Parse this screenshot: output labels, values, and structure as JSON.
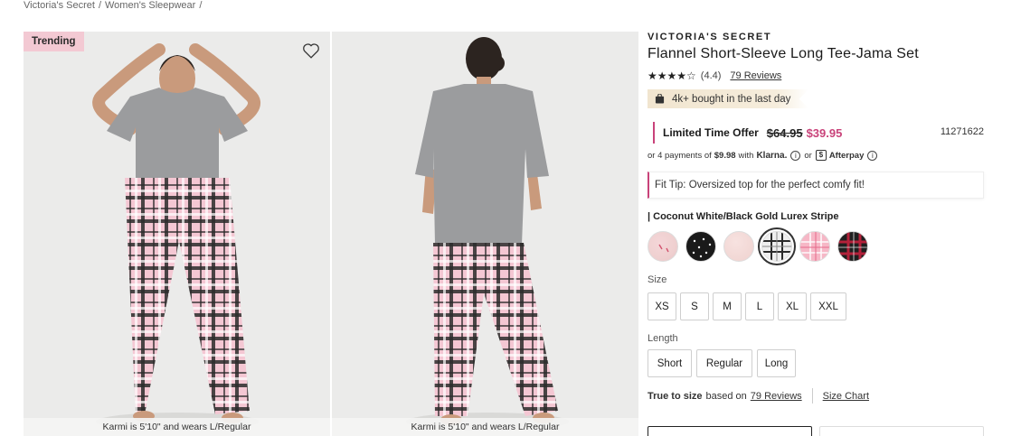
{
  "breadcrumb": {
    "items": [
      "Victoria's Secret",
      "Women's Sleepwear"
    ],
    "sep": "/"
  },
  "gallery": {
    "badge": "Trending",
    "caption_left": "Karmi is 5'10\" and wears L/Regular",
    "caption_right": "Karmi is 5'10\" and wears L/Regular"
  },
  "product": {
    "brand": "VICTORIA'S SECRET",
    "title": "Flannel Short-Sleeve Long Tee-Jama Set",
    "rating_stars": "★★★★☆",
    "rating": "(4.4)",
    "reviews": "79 Reviews",
    "bought": "4k+ bought in the last day",
    "offer_label": "Limited Time Offer",
    "old_price": "$64.95",
    "new_price": "$39.95",
    "sku": "11271622",
    "installments": {
      "prefix": "or 4 payments of",
      "amount": "$9.98",
      "with": "with",
      "klarna": "Klarna.",
      "or": "or",
      "afterpay": "Afterpay"
    },
    "fit_tip": "Fit Tip: Oversized top for the perfect comfy fit!",
    "color_label": "| Coconut White/Black Gold Lurex Stripe",
    "size_label": "Size",
    "sizes": [
      "XS",
      "S",
      "M",
      "L",
      "XL",
      "XXL"
    ],
    "length_label": "Length",
    "lengths": [
      "Short",
      "Regular",
      "Long"
    ],
    "true_to_size": {
      "strong": "True to size",
      "based_on": "based on",
      "reviews_link": "79 Reviews",
      "size_chart": "Size Chart"
    }
  },
  "colors": {
    "accent": "#c9437a",
    "badge_bg": "#f3c9d3",
    "bought_bg": "#f1e5cf"
  }
}
